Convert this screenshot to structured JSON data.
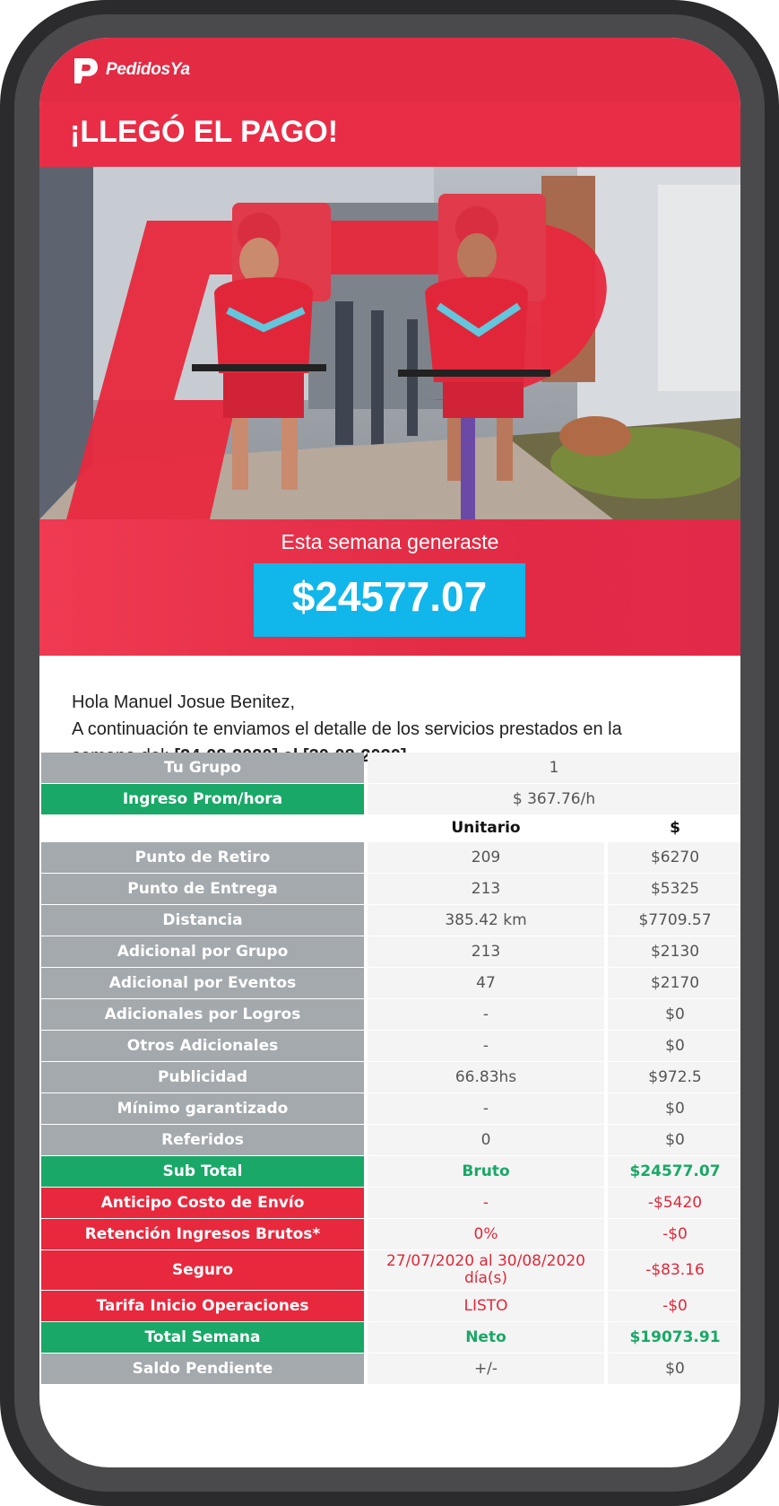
{
  "brand": {
    "name": "PedidosYa"
  },
  "headline": "¡LLEGÓ EL PAGO!",
  "earnings": {
    "label": "Esta semana generaste",
    "amount": "$24577.07"
  },
  "intro": {
    "greeting": "Hola Manuel Josue Benitez,",
    "line1": "A continuación te enviamos el detalle de los servicios prestados en la",
    "line2_prefix": "semana del: ",
    "date_from": "[24-08-2020]",
    "conj": " al ",
    "date_to": "[30-08-2020]"
  },
  "summary": [
    {
      "label": "Tu Grupo",
      "value": "1",
      "style": "gray"
    },
    {
      "label": "Ingreso Prom/hora",
      "value": "$ 367.76/h",
      "style": "green"
    }
  ],
  "columns": {
    "unit": "Unitario",
    "amount": "$"
  },
  "rows": [
    {
      "label": "Punto de Retiro",
      "unit": "209",
      "amount": "$6270",
      "style": "gray"
    },
    {
      "label": "Punto de Entrega",
      "unit": "213",
      "amount": "$5325",
      "style": "gray"
    },
    {
      "label": "Distancia",
      "unit": "385.42 km",
      "amount": "$7709.57",
      "style": "gray"
    },
    {
      "label": "Adicional por Grupo",
      "unit": "213",
      "amount": "$2130",
      "style": "gray"
    },
    {
      "label": "Adicional por Eventos",
      "unit": "47",
      "amount": "$2170",
      "style": "gray"
    },
    {
      "label": "Adicionales por Logros",
      "unit": "-",
      "amount": "$0",
      "style": "gray"
    },
    {
      "label": "Otros Adicionales",
      "unit": "-",
      "amount": "$0",
      "style": "gray"
    },
    {
      "label": "Publicidad",
      "unit": "66.83hs",
      "amount": "$972.5",
      "style": "gray"
    },
    {
      "label": "Mínimo garantizado",
      "unit": "-",
      "amount": "$0",
      "style": "gray"
    },
    {
      "label": "Referidos",
      "unit": "0",
      "amount": "$0",
      "style": "gray"
    },
    {
      "label": "Sub Total",
      "unit": "Bruto",
      "amount": "$24577.07",
      "style": "green"
    },
    {
      "label": "Anticipo Costo de Envío",
      "unit": "-",
      "amount": "-$5420",
      "style": "red"
    },
    {
      "label": "Retención Ingresos Brutos*",
      "unit": "0%",
      "amount": "-$0",
      "style": "red"
    },
    {
      "label": "Seguro",
      "unit": "27/07/2020 al 30/08/2020 día(s)",
      "amount": "-$83.16",
      "style": "red",
      "tall": true
    },
    {
      "label": "Tarifa Inicio Operaciones",
      "unit": "LISTO",
      "amount": "-$0",
      "style": "red"
    },
    {
      "label": "Total Semana",
      "unit": "Neto",
      "amount": "$19073.91",
      "style": "green"
    },
    {
      "label": "Saldo Pendiente",
      "unit": "+/-",
      "amount": "$0",
      "style": "gray"
    }
  ],
  "colors": {
    "brand_red": "#e32b44",
    "amount_box": "#11b6ea",
    "green": "#19a867",
    "gray": "#a4a9ae"
  }
}
